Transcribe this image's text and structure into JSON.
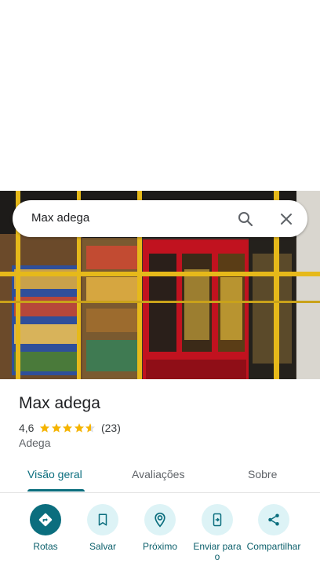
{
  "search": {
    "query": "Max adega",
    "search_icon": "search-icon",
    "close_icon": "close-icon"
  },
  "place": {
    "name": "Max adega",
    "rating": "4,6",
    "rating_value": 4.6,
    "review_count": "(23)",
    "category": "Adega"
  },
  "tabs": [
    {
      "label": "Visão geral",
      "active": true
    },
    {
      "label": "Avaliações",
      "active": false
    },
    {
      "label": "Sobre",
      "active": false
    }
  ],
  "actions": [
    {
      "label": "Rotas",
      "icon": "directions-icon"
    },
    {
      "label": "Salvar",
      "icon": "bookmark-icon"
    },
    {
      "label": "Próximo",
      "icon": "nearby-icon"
    },
    {
      "label": "Enviar para o",
      "icon": "send-to-phone-icon"
    },
    {
      "label": "Compartilhar",
      "icon": "share-icon"
    }
  ],
  "colors": {
    "accent": "#0b6e7e",
    "accent_light": "#ddf3f6",
    "star": "#f5b400"
  }
}
